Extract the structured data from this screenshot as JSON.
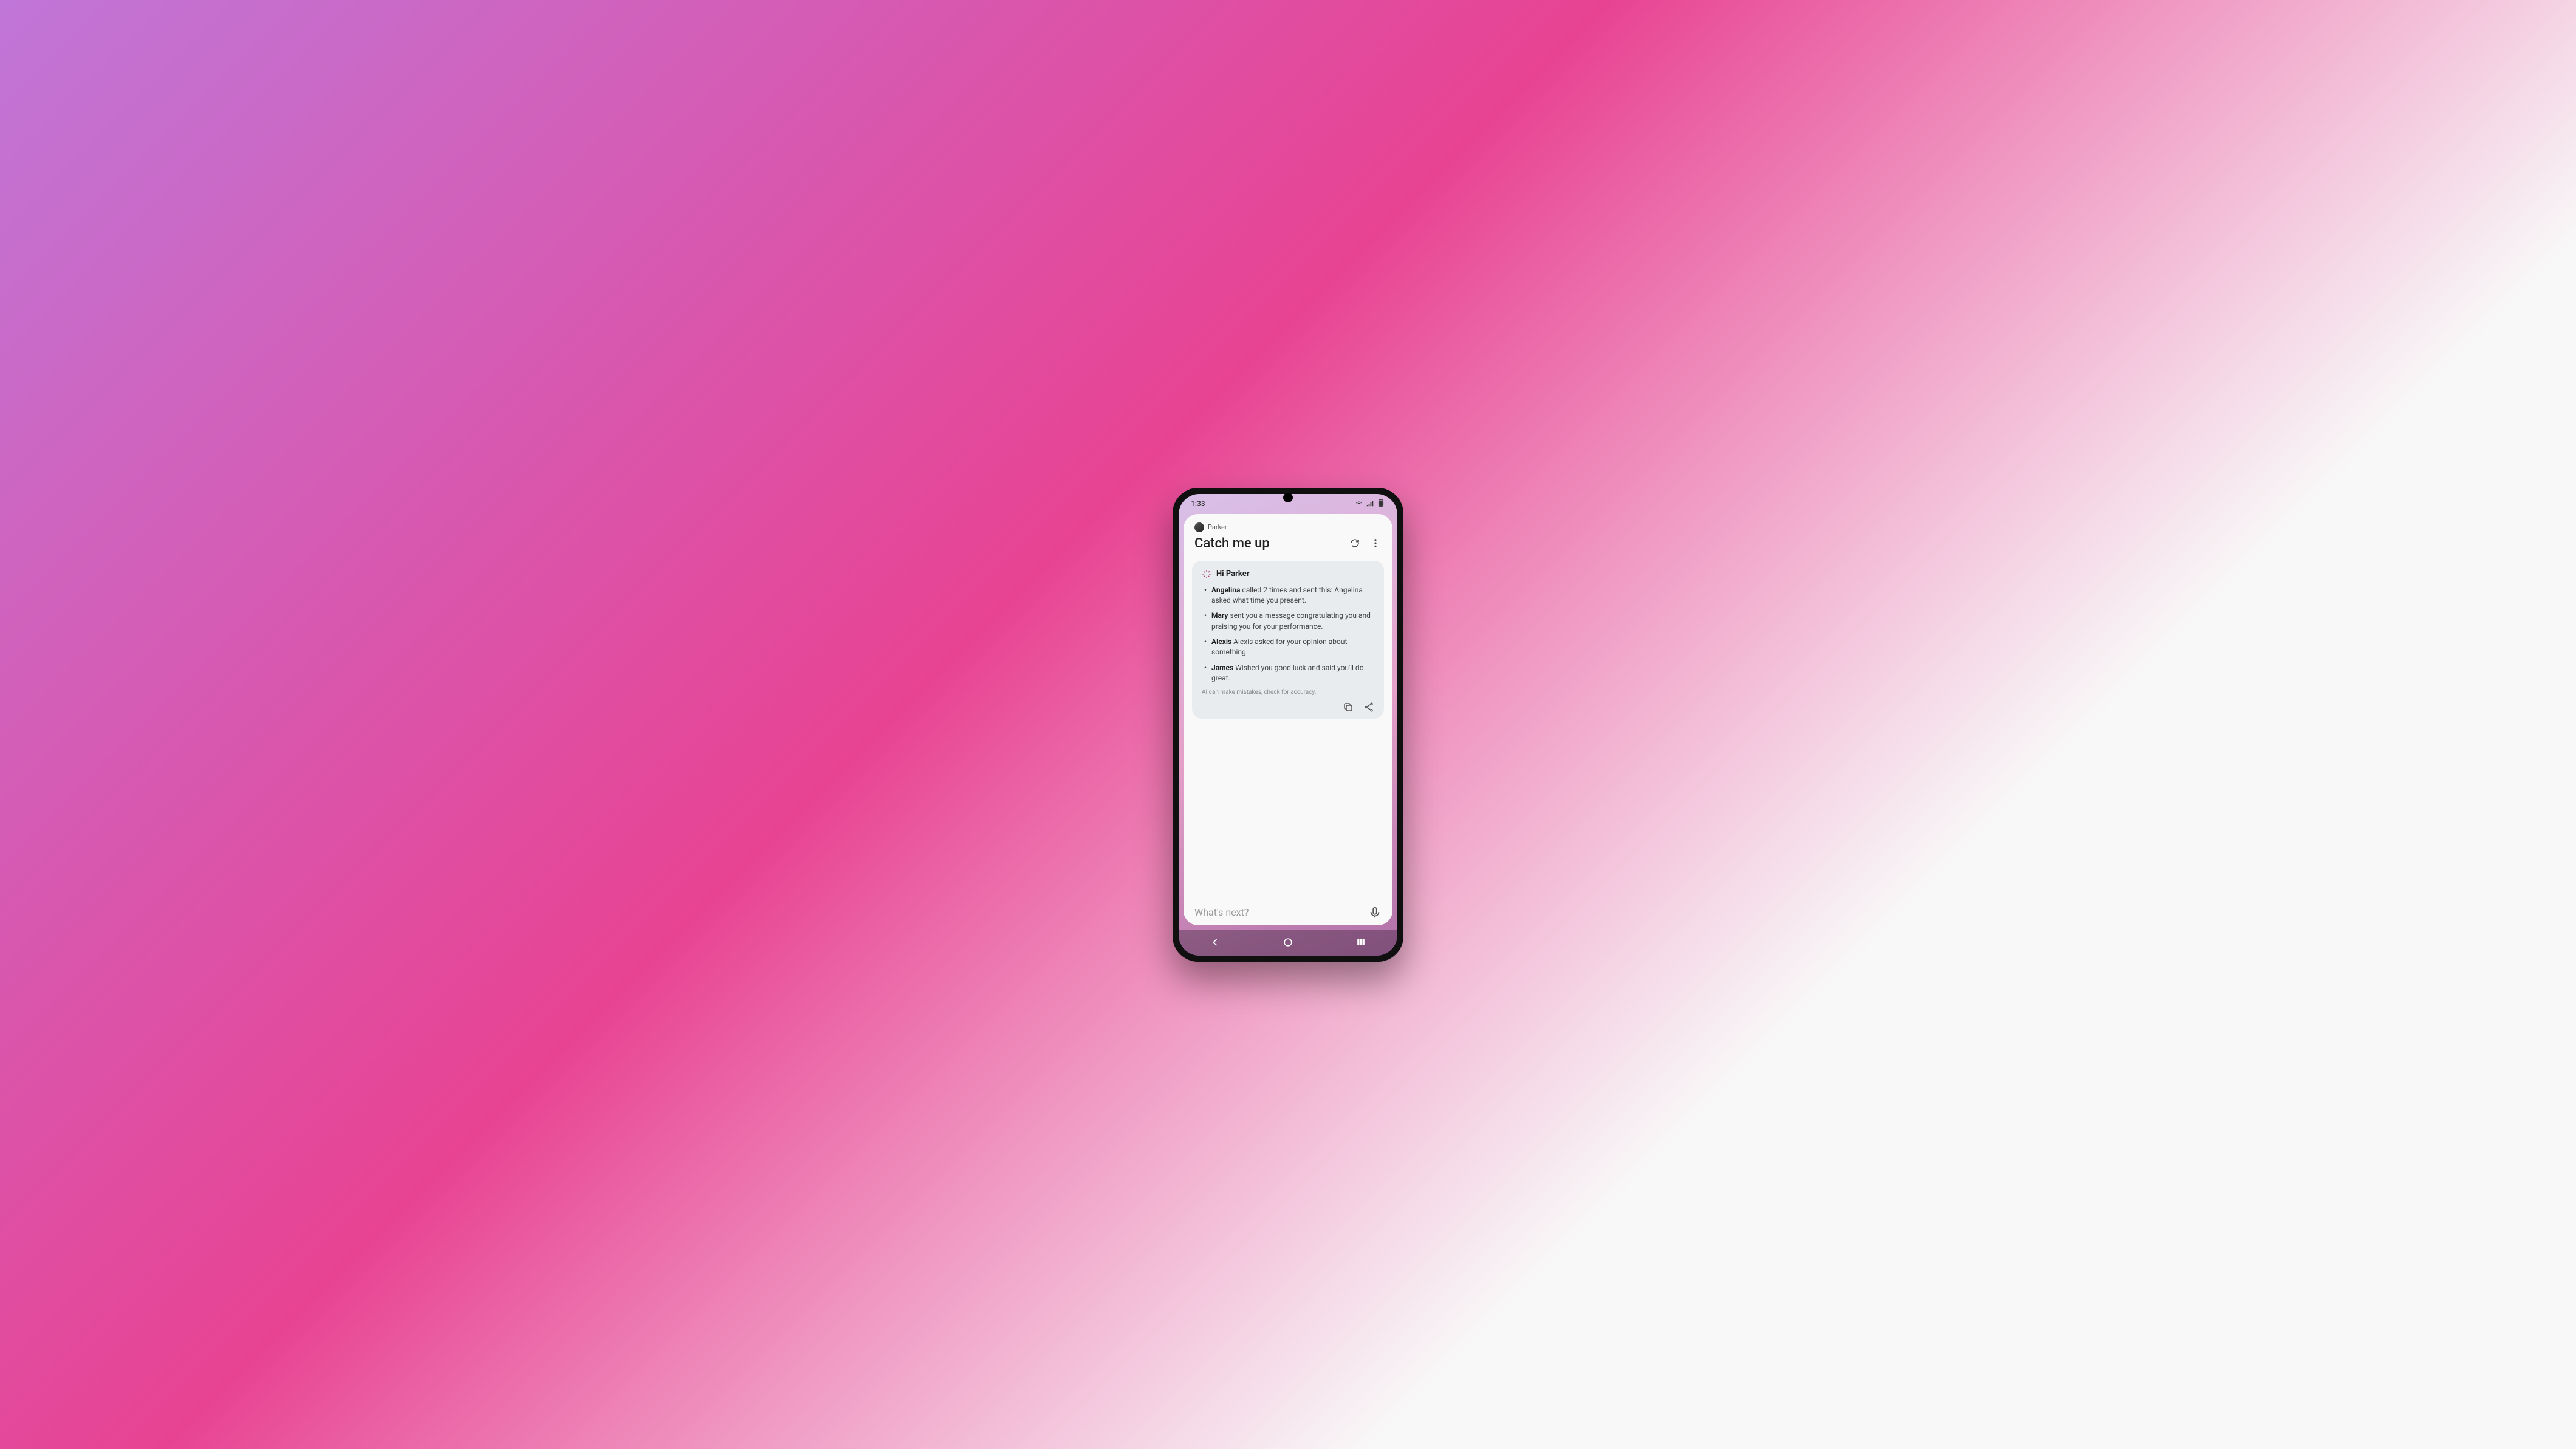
{
  "status": {
    "time": "1:33"
  },
  "header": {
    "user_name": "Parker",
    "title": "Catch me up"
  },
  "summary": {
    "greeting": "Hi Parker",
    "items": [
      {
        "name": "Angelina",
        "text": " called 2 times and sent this: Angelina asked what time you present."
      },
      {
        "name": "Mary",
        "text": " sent you a message congratulating you and praising you for your performance."
      },
      {
        "name": "Alexis",
        "text": " Alexis asked for your opinion about something."
      },
      {
        "name": "James",
        "text": " Wished you good luck and said you'll do great."
      }
    ],
    "disclaimer": "AI can make mistakes, check for accuracy."
  },
  "input": {
    "placeholder": "What's next?"
  }
}
